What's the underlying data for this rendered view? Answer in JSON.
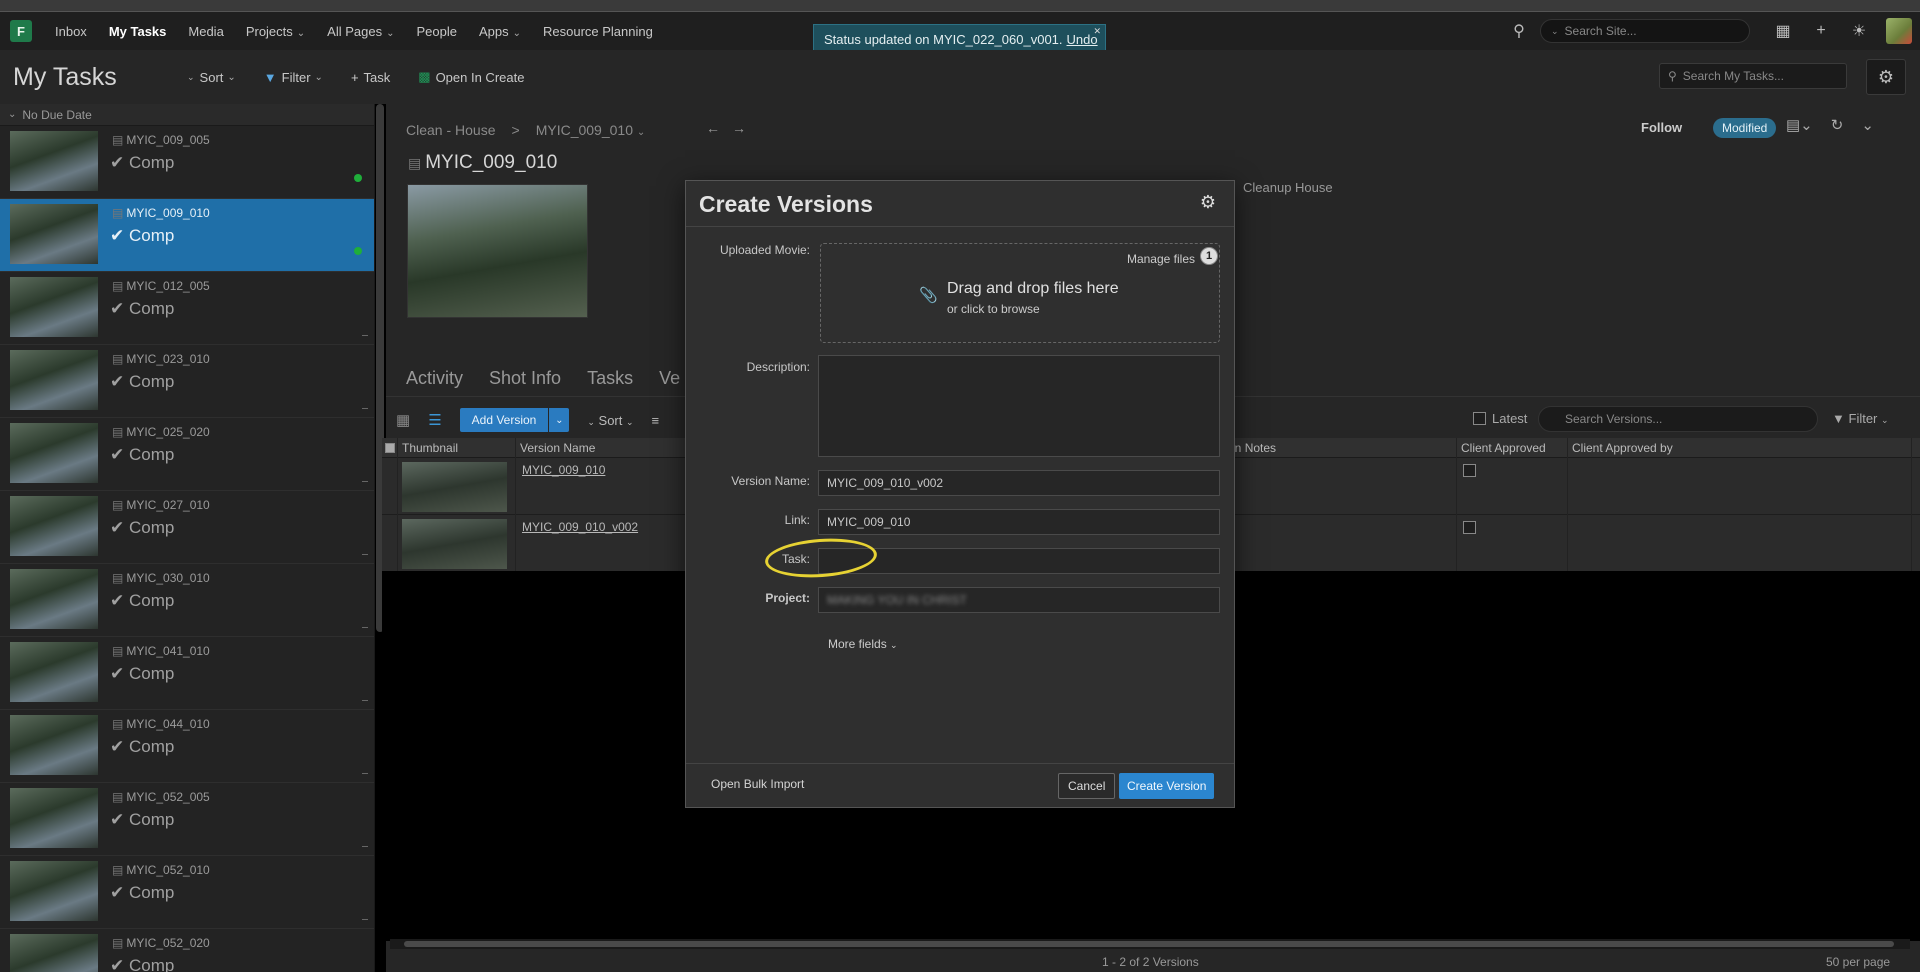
{
  "nav": {
    "logo": "F",
    "items": [
      {
        "label": "Inbox",
        "caret": false,
        "active": false
      },
      {
        "label": "My Tasks",
        "caret": false,
        "active": true
      },
      {
        "label": "Media",
        "caret": false,
        "active": false
      },
      {
        "label": "Projects",
        "caret": true,
        "active": false
      },
      {
        "label": "All Pages",
        "caret": true,
        "active": false
      },
      {
        "label": "People",
        "caret": false,
        "active": false
      },
      {
        "label": "Apps",
        "caret": true,
        "active": false
      },
      {
        "label": "Resource Planning",
        "caret": false,
        "active": false
      }
    ],
    "search_placeholder": "Search Site..."
  },
  "toast": {
    "message": "Status updated on MYIC_022_060_v001.",
    "undo": "Undo"
  },
  "header": {
    "title": "My Tasks",
    "sort": "Sort",
    "filter": "Filter",
    "task": "Task",
    "open_in_create": "Open In Create",
    "search_placeholder": "Search My Tasks..."
  },
  "tasks": {
    "group": "No Due Date",
    "items": [
      {
        "name": "MYIC_009_005",
        "step": "Comp",
        "selected": false,
        "dot": true
      },
      {
        "name": "MYIC_009_010",
        "step": "Comp",
        "selected": true,
        "dot": true
      },
      {
        "name": "MYIC_012_005",
        "step": "Comp",
        "selected": false,
        "dot": false
      },
      {
        "name": "MYIC_023_010",
        "step": "Comp",
        "selected": false,
        "dot": false
      },
      {
        "name": "MYIC_025_020",
        "step": "Comp",
        "selected": false,
        "dot": false
      },
      {
        "name": "MYIC_027_010",
        "step": "Comp",
        "selected": false,
        "dot": false
      },
      {
        "name": "MYIC_030_010",
        "step": "Comp",
        "selected": false,
        "dot": false
      },
      {
        "name": "MYIC_041_010",
        "step": "Comp",
        "selected": false,
        "dot": false
      },
      {
        "name": "MYIC_044_010",
        "step": "Comp",
        "selected": false,
        "dot": false
      },
      {
        "name": "MYIC_052_005",
        "step": "Comp",
        "selected": false,
        "dot": false
      },
      {
        "name": "MYIC_052_010",
        "step": "Comp",
        "selected": false,
        "dot": false
      },
      {
        "name": "MYIC_052_020",
        "step": "Comp",
        "selected": false,
        "dot": false
      }
    ]
  },
  "detail": {
    "breadcrumb_project": "Clean - House",
    "breadcrumb_sep": ">",
    "breadcrumb_shot": "MYIC_009_010",
    "title": "MYIC_009_010",
    "follow": "Follow",
    "status": "Modified",
    "description": "Cleanup House",
    "tabs": [
      "Activity",
      "Shot Info",
      "Tasks",
      "Ve"
    ]
  },
  "versions": {
    "add_version": "Add Version",
    "sort": "Sort",
    "latest": "Latest",
    "search_placeholder": "Search Versions...",
    "filter": "Filter",
    "columns": [
      "Thumbnail",
      "Version Name",
      "Open Notes",
      "Client Approved",
      "Client Approved by"
    ],
    "rows": [
      {
        "name": "MYIC_009_010"
      },
      {
        "name": "MYIC_009_010_v002"
      }
    ],
    "count": "1 - 2 of 2 Versions",
    "per_page": "50 per page"
  },
  "modal": {
    "title": "Create Versions",
    "uploaded_movie_label": "Uploaded Movie:",
    "manage_files": "Manage files",
    "file_count": "1",
    "drop_main": "Drag and drop files here",
    "drop_sub": "or click to browse",
    "description_label": "Description:",
    "version_name_label": "Version Name:",
    "version_name_value": "MYIC_009_010_v002",
    "link_label": "Link:",
    "link_value": "MYIC_009_010",
    "task_label": "Task:",
    "task_value": "",
    "project_label": "Project:",
    "project_value": "MAKING YOU IN CHRIST",
    "more_fields": "More fields",
    "bulk_import": "Open Bulk Import",
    "cancel": "Cancel",
    "create": "Create Version"
  },
  "colors": {
    "accent": "#2a7bc0",
    "selected_row": "#1f6fa8",
    "highlight_circle": "#e6d233",
    "status_dot": "#1fae3a"
  }
}
